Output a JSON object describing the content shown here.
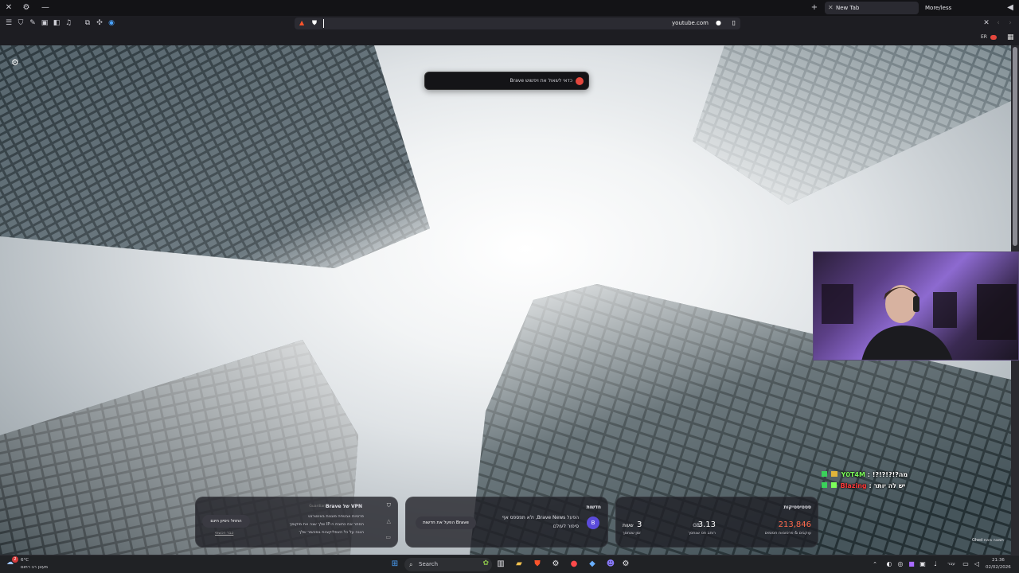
{
  "window": {
    "tabs": [
      {
        "label": "New Tab"
      },
      {
        "label": "More/less"
      }
    ]
  },
  "toolbar": {
    "url": "youtube.com"
  },
  "toast": {
    "text": "כדאי לשאול את ויפשוש Brave"
  },
  "profile": {
    "initials": "ER"
  },
  "cards": {
    "vpn": {
      "title": "VPN של Brave",
      "subtitle": "Guardian",
      "bullets": [
        "פרטיות אבטחה מוגנות באינטרנט",
        "הסתר את כתובת ה-IP שלך שנה את מיקומך",
        "הגנה על כל האפליקציות במכשיר שלך"
      ],
      "cta": "התחל ניסיון חינם",
      "link": "כבר רכשתי"
    },
    "news": {
      "title": "חדשות",
      "line1": "הפעל Brave News, ולא תפספס אף",
      "line2": "סיפור לעולם",
      "cta": "הפעל את חדשות Brave"
    },
    "stats": {
      "title": "סטטיסטיקות",
      "trackers_value": "213,846",
      "trackers_label": "עוקבים & פרסומות חסומים",
      "bandwidth_value": "3.13",
      "bandwidth_unit": "GB",
      "bandwidth_label": "רוחב פס שנחסך",
      "time_value": "3",
      "time_unit": "שעות",
      "time_label": "זמן שנחסך"
    }
  },
  "credit": "תמונה מאת Ghed",
  "chat": [
    {
      "user": "Y0T4M",
      "message": "!?!?!?!?מה"
    },
    {
      "user": "Blazing",
      "message": "יש לה יותר"
    }
  ],
  "colors": {
    "chat_user1": "#7cff5a",
    "chat_user2": "#ff3b3b",
    "stats_accent": "#ff6a4d",
    "brave_orange": "#fb542b"
  },
  "taskbar": {
    "weather_badge": "2",
    "weather_temp": "6°C",
    "weather_desc": "מעונן רב רחום",
    "search_label": "Search",
    "lang": "עבר",
    "time": "21:36",
    "date": "02/02/2026"
  }
}
